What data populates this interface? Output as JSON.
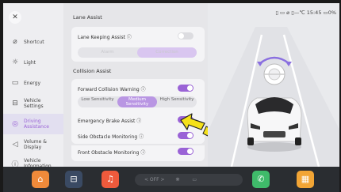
{
  "sidebar": {
    "items": [
      {
        "label": "Shortcut",
        "icon": "shortcut-icon"
      },
      {
        "label": "Light",
        "icon": "light-icon"
      },
      {
        "label": "Energy",
        "icon": "battery-icon"
      },
      {
        "label": "Vehicle Settings",
        "icon": "car-icon"
      },
      {
        "label": "Driving Assistance",
        "icon": "steering-wheel-icon",
        "active": true
      },
      {
        "label": "Volume & Display",
        "icon": "volume-icon"
      },
      {
        "label": "Vehicle Information",
        "icon": "info-icon"
      }
    ]
  },
  "lane_assist": {
    "title": "Lane Assist",
    "lka_label": "Lane Keeping Assist ⓘ",
    "lka_on": false,
    "mode_options": [
      "Alarm",
      "Correction"
    ],
    "mode_selected": "Correction"
  },
  "collision_assist": {
    "title": "Collision Assist",
    "fcw_label": "Forward Collision Warning ⓘ",
    "fcw_on": true,
    "sensitivity_options": [
      "Low Sensitivity",
      "Medium Sensitivity",
      "High Sensitivity"
    ],
    "sensitivity_selected": "Medium Sensitivity",
    "eba_label": "Emergency Brake Assist ⓘ",
    "eba_on": true,
    "som_label": "Side Obstacle Monitoring ⓘ",
    "som_on": true,
    "fom_label": "Front Obstacle Monitoring ⓘ",
    "fom_on": true
  },
  "status_bar": {
    "temp": "—℃",
    "time": "15:45",
    "battery": "0%"
  },
  "dock": {
    "climate_label": "< OFF >"
  },
  "colors": {
    "accent": "#9a63d6",
    "dock": "#2a2d31",
    "arrow": "#f5e11a"
  }
}
